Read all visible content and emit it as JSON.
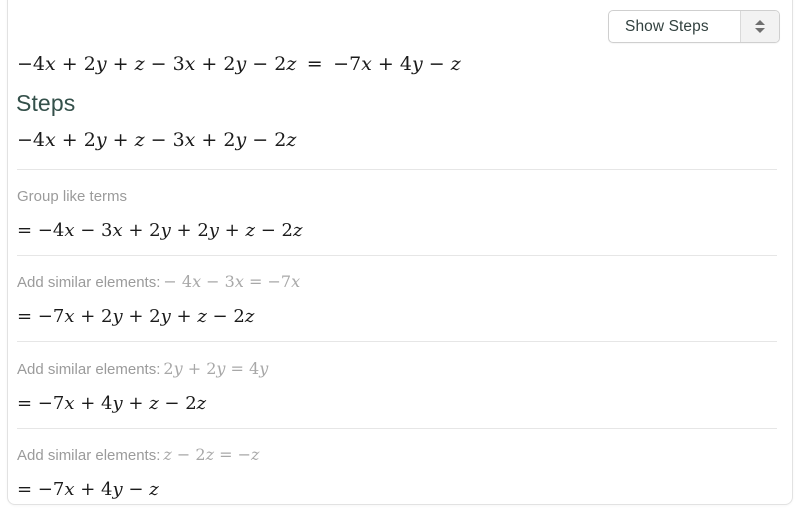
{
  "control": {
    "label": "Show Steps",
    "spinner_up_icon": "triangle-up-icon",
    "spinner_down_icon": "triangle-down-icon"
  },
  "heading": "Steps",
  "top_equation": {
    "lhs": "−4x + 2y + z − 3x + 2y − 2z",
    "equals": "=",
    "rhs": "−7x + 4y − z"
  },
  "initial_expression": "−4x + 2y + z − 3x + 2y − 2z",
  "steps": [
    {
      "label": "Group like terms",
      "label_math": "",
      "result": "= −4x − 3x + 2y + 2y + z − 2z"
    },
    {
      "label": "Add similar elements:",
      "label_math": "− 4x − 3x = −7x",
      "result": "= −7x + 2y + 2y + z − 2z"
    },
    {
      "label": "Add similar elements:",
      "label_math": "2y + 2y = 4y",
      "result": "= −7x + 4y + z − 2z"
    },
    {
      "label": "Add similar elements:",
      "label_math": "z − 2z = −z",
      "result": "= −7x + 4y − z"
    }
  ],
  "colors": {
    "heading": "#34504a",
    "label_gray": "#9b9b9b",
    "math_black": "#1b1b1b",
    "divider": "#e6e6e6",
    "card_border": "#e2e2e2"
  }
}
